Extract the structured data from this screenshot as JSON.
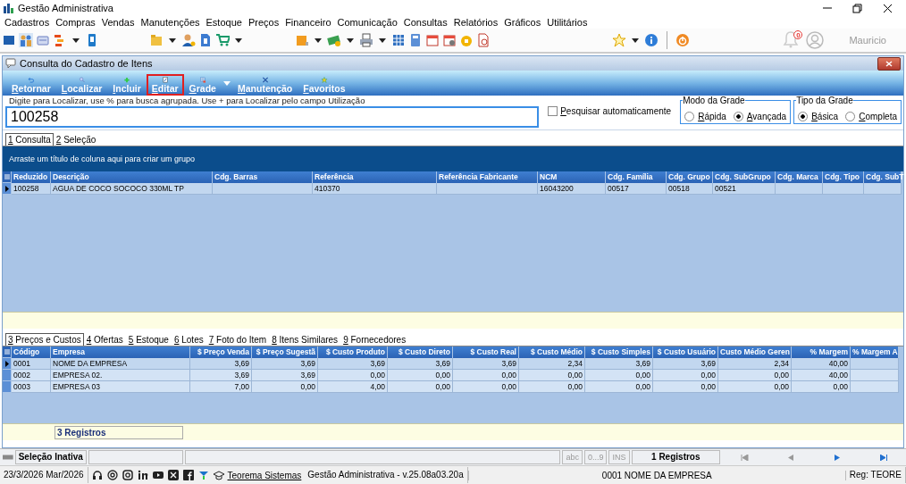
{
  "window": {
    "title": "Gestão Administrativa"
  },
  "menu": [
    "Cadastros",
    "Compras",
    "Vendas",
    "Manutenções",
    "Estoque",
    "Preços",
    "Financeiro",
    "Comunicação",
    "Consultas",
    "Relatórios",
    "Gráficos",
    "Utilitários"
  ],
  "user": {
    "notifications": "0",
    "name": "Mauricio"
  },
  "form": {
    "title": "Consulta do Cadastro de Itens"
  },
  "toolbar": [
    {
      "label": "Retornar",
      "selected": false
    },
    {
      "label": "Localizar",
      "selected": false
    },
    {
      "label": "Incluir",
      "selected": false
    },
    {
      "label": "Editar",
      "selected": true
    },
    {
      "label": "Grade",
      "selected": false
    },
    {
      "label": "Manutenção",
      "selected": false
    },
    {
      "label": "Favoritos",
      "selected": false
    }
  ],
  "search": {
    "label": "Digite para Localizar, use % para busca agrupada. Use + para Localizar pelo campo Utilização",
    "value": "100258"
  },
  "auto_search": {
    "label": "Pesquisar automaticamente",
    "checked": false
  },
  "option_groups": [
    {
      "title": "Modo da Grade",
      "options": [
        {
          "label": "Rápida",
          "selected": false
        },
        {
          "label": "Avançada",
          "selected": true
        }
      ]
    },
    {
      "title": "Tipo da Grade",
      "options": [
        {
          "label": "Básica",
          "selected": true
        },
        {
          "label": "Completa",
          "selected": false
        }
      ]
    }
  ],
  "tabs": [
    {
      "label": "1 Consulta",
      "selected": true
    },
    {
      "label": "2 Seleção",
      "selected": false
    }
  ],
  "group_hint": "Arraste um título de coluna aqui para criar um grupo",
  "table": {
    "columns": [
      "Reduzido",
      "Descrição",
      "Cdg. Barras",
      "Referência",
      "Referência Fabricante",
      "NCM",
      "Cdg. Família",
      "Cdg. Grupo",
      "Cdg. SubGrupo",
      "Cdg. Marca",
      "Cdg. Tipo",
      "Cdg. SubT"
    ],
    "rows": [
      {
        "selected": true,
        "cells": [
          "100258",
          "AGUA DE COCO SOCOCO 330ML TP",
          "",
          "410370",
          "",
          "16043200",
          "00517",
          "00518",
          "00521",
          "",
          "",
          ""
        ]
      }
    ]
  },
  "detail_tabs": [
    {
      "label": "3 Preços e Custos",
      "selected": true
    },
    {
      "label": "4 Ofertas",
      "selected": false
    },
    {
      "label": "5 Estoque",
      "selected": false
    },
    {
      "label": "6 Lotes",
      "selected": false
    },
    {
      "label": "7 Foto do Item",
      "selected": false
    },
    {
      "label": "8 Itens Similares",
      "selected": false
    },
    {
      "label": "9 Fornecedores",
      "selected": false
    }
  ],
  "detail_table": {
    "columns": [
      "Código",
      "Empresa",
      "$ Preço Venda",
      "$ Preço Sugestã",
      "$ Custo Produto",
      "$ Custo Direto",
      "$ Custo Real",
      "$ Custo Médio",
      "$ Custo Simples",
      "$ Custo Usuário",
      "Custo Médio Geren",
      "% Margem",
      "% Margem A"
    ],
    "rows": [
      {
        "selected": true,
        "cells": [
          "0001",
          "NOME DA EMPRESA",
          "3,69",
          "3,69",
          "3,69",
          "3,69",
          "3,69",
          "2,34",
          "3,69",
          "3,69",
          "2,34",
          "40,00",
          ""
        ]
      },
      {
        "selected": false,
        "cells": [
          "0002",
          "EMPRESA 02.",
          "3,69",
          "3,69",
          "0,00",
          "0,00",
          "0,00",
          "0,00",
          "0,00",
          "0,00",
          "0,00",
          "40,00",
          ""
        ]
      },
      {
        "selected": false,
        "cells": [
          "0003",
          "EMPRESA 03",
          "7,00",
          "0,00",
          "4,00",
          "0,00",
          "0,00",
          "0,00",
          "0,00",
          "0,00",
          "0,00",
          "0,00",
          ""
        ]
      }
    ]
  },
  "detail_footer": "3 Registros",
  "status_bar": {
    "selection": "Seleção Inativa",
    "indicators": [
      "abc",
      "0...9",
      "INS"
    ],
    "records": "1 Registros"
  },
  "bottom_bar": {
    "date": "23/3/2026 Mar/2026",
    "link": "Teorema Sistemas",
    "version": "Gestão Administrativa - v.25.08a03.20a",
    "company": "0001 NOME DA EMPRESA",
    "reg": "Reg: TEORE"
  }
}
